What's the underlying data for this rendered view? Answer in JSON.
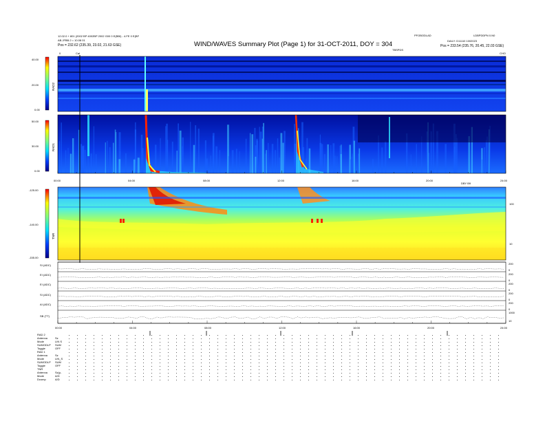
{
  "header": {
    "left_line1": "12.02.0 + 801 (2002 BP 4002BP 2002 G00 0 E(BBI) - 4.FE 0 E(BF",
    "left_line2": "AB.JFBB.2 = 10.08 01",
    "left_pos": "Pos = 232.62 (235.39, 23.02, 21.63 GSE)",
    "title": "WIND/WAVES Summary Plot (Page 1) for 31-OCT-2011, DOY = 304",
    "mid_right_line1": "PFOBODLAD",
    "mid_right_line2": "TBSPDS",
    "right_line1": "LDBPDDPN 0.N0",
    "right_line2": "DAILY: D11110 1002023",
    "right_pos": "Pos = 233.54 (235.76, 20.45, 22.03 GSE)",
    "marker": "Cal",
    "marker_right": "CHO",
    "marker_0": "0"
  },
  "chart_data": [
    {
      "type": "heatmap",
      "name": "RAD2",
      "ylabel": "RAD2",
      "yticks": [
        "40.00",
        "20.00",
        "0.00"
      ],
      "ylim": [
        0,
        40
      ],
      "colorbar": true
    },
    {
      "type": "heatmap",
      "name": "RAD1",
      "ylabel": "RAD1",
      "yticks": [
        "50.00",
        "30.00",
        "0.00"
      ],
      "ylim": [
        0,
        50
      ],
      "colorbar": true
    },
    {
      "type": "heatmap",
      "name": "TNR",
      "ylabel": "TNR",
      "yticks": [
        "-125.00",
        "-140.00",
        "-155.00"
      ],
      "ylim": [
        -155,
        -125
      ],
      "right_ticks": [
        "100",
        "10"
      ],
      "right_label": "DBY B9",
      "colorbar": true
    },
    {
      "type": "line",
      "name": "Housekeeping",
      "rows": [
        {
          "label": "SI (ADC)",
          "right": [
            "200",
            "0"
          ]
        },
        {
          "label": "EI (ADC)",
          "right": [
            "200",
            "0"
          ]
        },
        {
          "label": "EI (ADC)",
          "right": [
            "200",
            "0"
          ]
        },
        {
          "label": "SI (ADC)",
          "right": [
            "200",
            "0"
          ]
        },
        {
          "label": "AI (ADC)",
          "right": [
            "200",
            "0"
          ]
        },
        {
          "label": "SB (TT)",
          "right": [
            "1000",
            "10"
          ]
        }
      ]
    }
  ],
  "time_axis": [
    "00:00",
    "04:00",
    "08:00",
    "12:00",
    "16:00",
    "20:00",
    "24:00"
  ],
  "params": {
    "rad2": {
      "heading": "RAD 2",
      "rows": [
        [
          "Antenna",
          "Sz"
        ],
        [
          "Mode",
          "LIN S"
        ],
        [
          "SUMODLP",
          "SUM"
        ],
        [
          "Toggle",
          "OFF"
        ]
      ]
    },
    "rad1": {
      "heading": "RAD 1",
      "rows": [
        [
          "Antenna",
          "Sz"
        ],
        [
          "Mode",
          "LIN_S"
        ],
        [
          "SUMODLP",
          "SUM"
        ],
        [
          "Toggle",
          "OFF"
        ]
      ]
    },
    "tnr": {
      "heading": "TNR",
      "rows": [
        [
          "Antenna",
          "Sz(y-"
        ],
        [
          "Mode",
          "A/D"
        ],
        [
          "Dcomp",
          "A/D"
        ]
      ]
    }
  },
  "colors": {
    "dark_blue": "#0000aa",
    "blue": "#0033ff",
    "cyan": "#00ffff",
    "yellow": "#ffff00",
    "red": "#ff0000"
  }
}
